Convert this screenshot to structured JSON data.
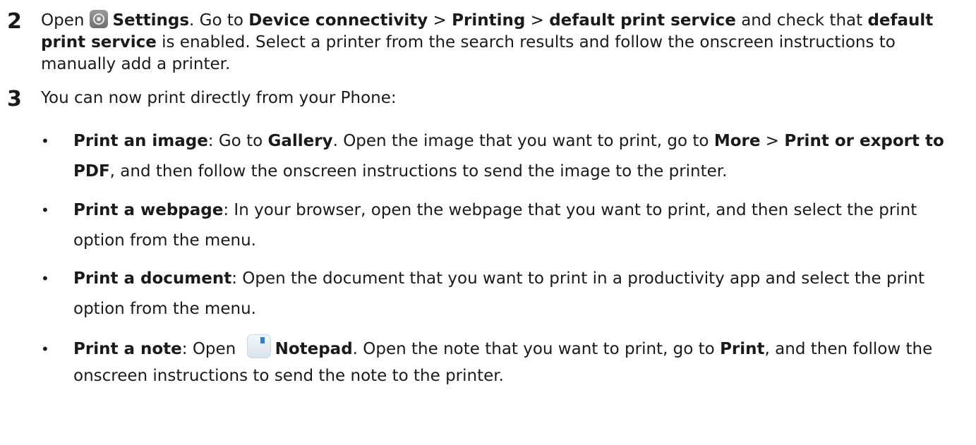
{
  "step2": {
    "number": "2",
    "open": "Open",
    "settings": "Settings",
    "goto": ". Go to ",
    "device_connectivity": "Device connectivity",
    "sep1": " > ",
    "printing": "Printing",
    "sep2": " > ",
    "default_print_service": "default print service",
    "and_check": " and check that ",
    "default_print_service_2": "default print service",
    "rest": " is enabled. Select a printer from the search results and follow the onscreen instructions to manually add a printer."
  },
  "step3": {
    "number": "3",
    "intro": "You can now print directly from your Phone:"
  },
  "bullets": [
    {
      "title": "Print an image",
      "p1": ": Go to ",
      "gallery": "Gallery",
      "p2": ". Open the image that you want to print, go to ",
      "more": "More",
      "sep": " > ",
      "print_export": "Print or export to PDF",
      "p3": ", and then follow the onscreen instructions to send the image to the printer."
    },
    {
      "title": "Print a webpage",
      "p1": ": In your browser, open the webpage that you want to print, and then select the print option from the menu."
    },
    {
      "title": "Print a document",
      "p1": ": Open the document that you want to print in a productivity app and select the print option from the menu."
    },
    {
      "title": "Print a note",
      "p1": ": Open ",
      "notepad": "Notepad",
      "p2": ". Open the note that you want to print, go to ",
      "print": "Print",
      "p3": ", and then follow the onscreen instructions to send the note to the printer."
    }
  ],
  "bullet_glyph": "•",
  "icons": [
    "settings-icon",
    "notepad-icon"
  ]
}
